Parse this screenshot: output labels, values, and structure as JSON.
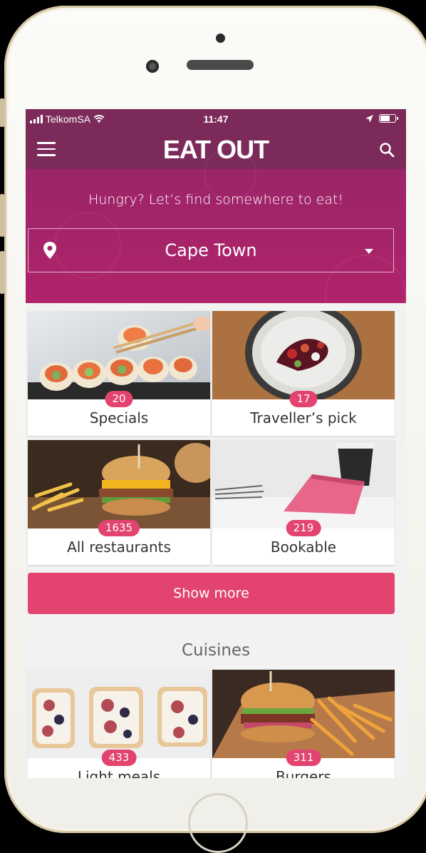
{
  "status_bar": {
    "carrier": "TelkomSA",
    "time": "11:47"
  },
  "app_bar": {
    "logo": "EAT OUT",
    "menu_icon": "hamburger-icon",
    "search_icon": "search-icon"
  },
  "hero": {
    "title": "Hungry? Let’s find somewhere to eat!",
    "location": "Cape Town",
    "location_icon": "map-pin-icon"
  },
  "categories": [
    {
      "label": "Specials",
      "count": "20"
    },
    {
      "label": "Traveller’s pick",
      "count": "17"
    },
    {
      "label": "All restaurants",
      "count": "1635"
    },
    {
      "label": "Bookable",
      "count": "219"
    }
  ],
  "show_more_label": "Show more",
  "cuisines": {
    "title": "Cuisines",
    "items": [
      {
        "label": "Light meals",
        "count": "433"
      },
      {
        "label": "Burgers",
        "count": "311"
      }
    ]
  },
  "colors": {
    "app_bar": "#7c2a5a",
    "hero": "#b0236a",
    "accent": "#e2436f"
  }
}
